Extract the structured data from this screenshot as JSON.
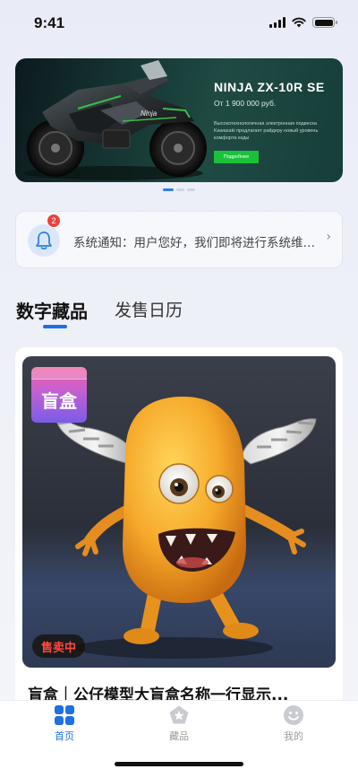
{
  "status_bar": {
    "time": "9:41"
  },
  "banner": {
    "title": "NINJA ZX-10R SE",
    "price": "От 1 900 000 руб.",
    "description": "Высокотехнологичная электронная подвеска Kawasaki предлагает райдеру новый уровень комфорта езды",
    "button_label": "Подробнее",
    "moto_brand": "Ninja"
  },
  "notice": {
    "badge_count": "2",
    "text": "系统通知：用户您好，我们即将进行系统维护升级",
    "arrow": "›"
  },
  "tabs": [
    {
      "label": "数字藏品",
      "active": true
    },
    {
      "label": "发售日历",
      "active": false
    }
  ],
  "product": {
    "box_label": "盲盒",
    "sale_status": "售卖中",
    "title": "盲盒｜公仔模型大盲盒名称一行显示..."
  },
  "tabbar": [
    {
      "label": "首页",
      "icon": "grid-icon",
      "active": true
    },
    {
      "label": "藏品",
      "icon": "pentagon-star-icon",
      "active": false
    },
    {
      "label": "我的",
      "icon": "smile-icon",
      "active": false
    }
  ],
  "colors": {
    "accent": "#1f6fe5",
    "sale": "#ff4a3d",
    "badge": "#ee3f3f",
    "banner_button": "#1ac23b"
  }
}
